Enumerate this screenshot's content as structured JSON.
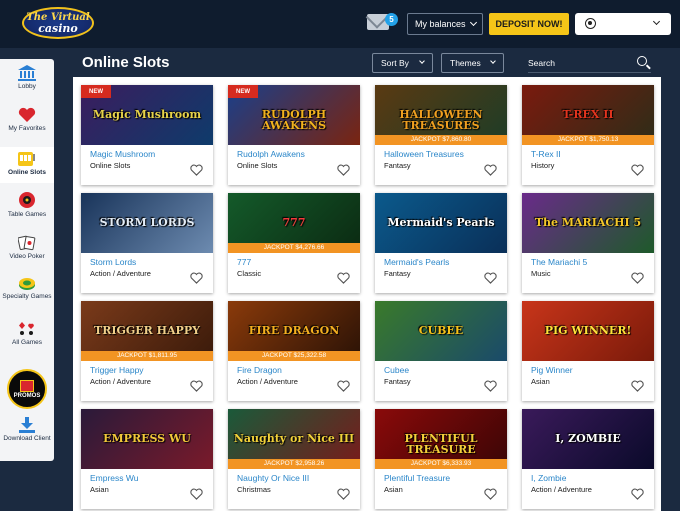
{
  "header": {
    "logo_line1": "The Virtual",
    "logo_line2": "casino",
    "messages_count": "5",
    "balances_label": "My balances",
    "deposit_label": "DEPOSIT NOW!"
  },
  "sidebar": {
    "items": [
      {
        "label": "Lobby",
        "icon": "bank-icon"
      },
      {
        "label": "My Favorites",
        "icon": "heart-icon"
      },
      {
        "label": "Online Slots",
        "icon": "slot-machine-icon",
        "active": true
      },
      {
        "label": "Table Games",
        "icon": "roulette-icon"
      },
      {
        "label": "Video Poker",
        "icon": "cards-icon"
      },
      {
        "label": "Specialty Games",
        "icon": "specialty-icon"
      },
      {
        "label": "All Games",
        "icon": "card-suits-icon"
      },
      {
        "label": "PROMOS",
        "icon": "gift-icon"
      },
      {
        "label": "Download Client",
        "icon": "download-icon"
      }
    ]
  },
  "main": {
    "title": "Online Slots",
    "sort_label": "Sort By",
    "themes_label": "Themes",
    "search_placeholder": "Search"
  },
  "games": [
    {
      "name": "Magic Mushroom",
      "category": "Online Slots",
      "badge": "NEW",
      "jackpot": "",
      "thumb_title": "Magic Mushroom",
      "colors": [
        "#3b1d5e",
        "#0e3b6b"
      ],
      "title_color": "#e7d24a"
    },
    {
      "name": "Rudolph Awakens",
      "category": "Online Slots",
      "badge": "NEW",
      "jackpot": "",
      "thumb_title": "RUDOLPH AWAKENS",
      "colors": [
        "#1a3f8a",
        "#7a2410"
      ],
      "title_color": "#f2b21f"
    },
    {
      "name": "Halloween Treasures",
      "category": "Fantasy",
      "badge": "",
      "jackpot": "JACKPOT $7,860.80",
      "thumb_title": "HALLOWEEN TREASURES",
      "colors": [
        "#5a3a12",
        "#1d3c27"
      ],
      "title_color": "#f0a020"
    },
    {
      "name": "T-Rex II",
      "category": "History",
      "badge": "",
      "jackpot": "JACKPOT $1,750.13",
      "thumb_title": "T-REX II",
      "colors": [
        "#7a1a0e",
        "#2d2d18"
      ],
      "title_color": "#e2341e"
    },
    {
      "name": "Storm Lords",
      "category": "Action / Adventure",
      "badge": "",
      "jackpot": "",
      "thumb_title": "STORM LORDS",
      "colors": [
        "#19345a",
        "#6d8bb0"
      ],
      "title_color": "#e4edf7"
    },
    {
      "name": "777",
      "category": "Classic",
      "badge": "",
      "jackpot": "JACKPOT $4,276.66",
      "thumb_title": "777",
      "colors": [
        "#145a2a",
        "#0b2a12"
      ],
      "title_color": "#f23a3a"
    },
    {
      "name": "Mermaid's Pearls",
      "category": "Fantasy",
      "badge": "",
      "jackpot": "",
      "thumb_title": "Mermaid's Pearls",
      "colors": [
        "#0b5a8c",
        "#0a2f58"
      ],
      "title_color": "#ffffff"
    },
    {
      "name": "The Mariachi 5",
      "category": "Music",
      "badge": "",
      "jackpot": "",
      "thumb_title": "The MARIACHI 5",
      "colors": [
        "#6a2a8a",
        "#1e5a2a"
      ],
      "title_color": "#f4c82a"
    },
    {
      "name": "Trigger Happy",
      "category": "Action / Adventure",
      "badge": "",
      "jackpot": "JACKPOT $1,811.95",
      "thumb_title": "TRIGGER HAPPY",
      "colors": [
        "#7a3a1a",
        "#3a1a0a"
      ],
      "title_color": "#f2d08a"
    },
    {
      "name": "Fire Dragon",
      "category": "Action / Adventure",
      "badge": "",
      "jackpot": "JACKPOT $25,322.58",
      "thumb_title": "FIRE DRAGON",
      "colors": [
        "#8a3a0a",
        "#2a1206"
      ],
      "title_color": "#f5b020"
    },
    {
      "name": "Cubee",
      "category": "Fantasy",
      "badge": "",
      "jackpot": "",
      "thumb_title": "CUBEE",
      "colors": [
        "#3a7a2a",
        "#1a4a6a"
      ],
      "title_color": "#f6c21a"
    },
    {
      "name": "Pig Winner",
      "category": "Asian",
      "badge": "",
      "jackpot": "",
      "thumb_title": "PIG WINNER!",
      "colors": [
        "#c8351a",
        "#7a1a0a"
      ],
      "title_color": "#ffe23a"
    },
    {
      "name": "Empress Wu",
      "category": "Asian",
      "badge": "",
      "jackpot": "",
      "thumb_title": "EMPRESS WU",
      "colors": [
        "#2a1a3a",
        "#7a1a2a"
      ],
      "title_color": "#f2c83a"
    },
    {
      "name": "Naughty Or Nice III",
      "category": "Christmas",
      "badge": "",
      "jackpot": "JACKPOT $2,958.26",
      "thumb_title": "Naughty or Nice III",
      "colors": [
        "#1a5a3a",
        "#7a1a1a"
      ],
      "title_color": "#f2d23a"
    },
    {
      "name": "Plentiful Treasure",
      "category": "Asian",
      "badge": "",
      "jackpot": "JACKPOT $6,333.93",
      "thumb_title": "PLENTIFUL TREASURE",
      "colors": [
        "#8a0a0a",
        "#3a0505"
      ],
      "title_color": "#f6cf3a"
    },
    {
      "name": "I, Zombie",
      "category": "Action / Adventure",
      "badge": "",
      "jackpot": "",
      "thumb_title": "I, ZOMBIE",
      "colors": [
        "#3a1a5a",
        "#0a0a2a"
      ],
      "title_color": "#ffffff"
    }
  ]
}
